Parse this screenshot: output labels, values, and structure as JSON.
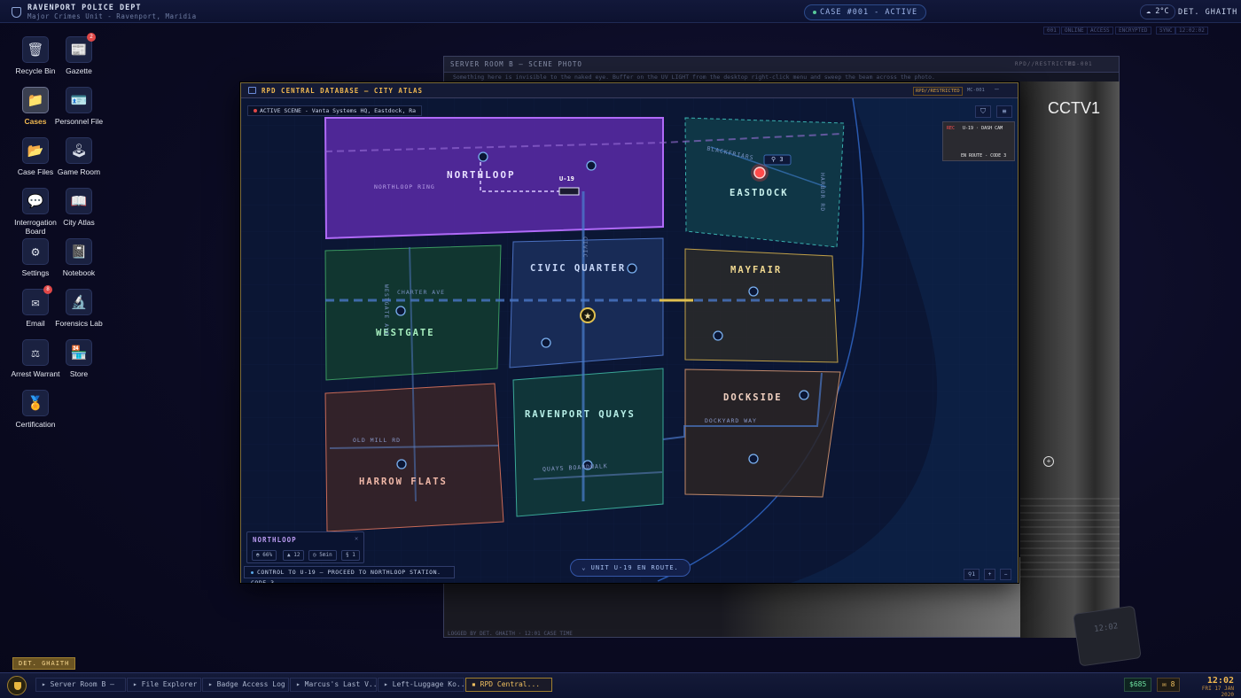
{
  "topbar": {
    "dept": "RAVENPORT POLICE DEPT",
    "unit": "Major Crimes Unit - Ravenport, Maridia",
    "case": "CASE #001 - ACTIVE",
    "weather": "2°C",
    "user": "DET. GHAITH",
    "status_chips": [
      "001",
      "ONLINE",
      "ACCESS",
      "ENCRYPTED",
      "SYNC",
      "12:02:02"
    ]
  },
  "desktop_icons": [
    {
      "label": "Recycle Bin",
      "icon": "trash-icon"
    },
    {
      "label": "Gazette",
      "icon": "newspaper-icon",
      "badge": "2"
    },
    {
      "label": "Cases",
      "icon": "folder-icon",
      "selected": true
    },
    {
      "label": "Personnel File",
      "icon": "id-card-icon"
    },
    {
      "label": "Case Files",
      "icon": "folder-icon"
    },
    {
      "label": "Game Room",
      "icon": "joystick-icon"
    },
    {
      "label": "Interrogation Board",
      "icon": "speech-bubble-icon"
    },
    {
      "label": "City Atlas",
      "icon": "map-book-icon"
    },
    {
      "label": "Settings",
      "icon": "gear-icon"
    },
    {
      "label": "Notebook",
      "icon": "notebook-icon"
    },
    {
      "label": "Email",
      "icon": "envelope-icon",
      "badge": "8"
    },
    {
      "label": "Forensics Lab",
      "icon": "microscope-icon"
    },
    {
      "label": "Arrest Warrant",
      "icon": "scales-icon"
    },
    {
      "label": "Store",
      "icon": "shop-icon"
    },
    {
      "label": "Certification",
      "icon": "medal-icon"
    }
  ],
  "server_window": {
    "title": "SERVER ROOM B — SCENE PHOTO",
    "restricted": "RPD//RESTRICTED",
    "code": "MC-001",
    "hint": "Something here is invisible to the naked eye. Buffer on the UV LIGHT from the desktop right-click menu and sweep the beam across the photo.",
    "cctv_label": "CCTV1",
    "timestamp": "12:02",
    "footer": "LOGGED BY DET. GHAITH · 12:01 CASE TIME"
  },
  "atlas_window": {
    "title": "RPD CENTRAL DATABASE — CITY ATLAS",
    "restricted": "RPD//RESTRICTED",
    "code": "MC-001",
    "active_scene": "ACTIVE SCENE - Vanta Systems HQ, Eastdock, Ra",
    "districts": [
      {
        "name": "NORTHLOOP",
        "color": "#8a50f0"
      },
      {
        "name": "EASTDOCK",
        "color": "#3aa8a0"
      },
      {
        "name": "CIVIC QUARTER",
        "color": "#4a70c0"
      },
      {
        "name": "MAYFAIR",
        "color": "#c0a048"
      },
      {
        "name": "WESTGATE",
        "color": "#3a9860"
      },
      {
        "name": "RAVENPORT QUAYS",
        "color": "#3aa898"
      },
      {
        "name": "DOCKSIDE",
        "color": "#c08868"
      },
      {
        "name": "HARROW FLATS",
        "color": "#c86a58"
      }
    ],
    "streets": [
      "NORTHLOOP RING",
      "CHARTER AVE",
      "WESTGATE AVE",
      "OLD MILL RD",
      "QUAYS BOARDWALK",
      "DOCKYARD WAY",
      "HARBOR RD",
      "BLACKFRIARS",
      "CIVIC"
    ],
    "unit_marker": "U-19",
    "blackfriars_count": "3",
    "inset": {
      "rec": "REC",
      "cam": "U-19 · DASH CAM",
      "status": "EN ROUTE - CODE 3"
    },
    "info_panel": {
      "name": "NORTHLOOP",
      "stats": [
        "66%",
        "12",
        "5min",
        "1"
      ]
    },
    "dispatch": "CONTROL TO U-19 — PROCEED TO NORTHLOOP STATION. CODE 3.",
    "unit_status": "UNIT U-19 EN ROUTE.",
    "controls": [
      "1",
      "+",
      "−"
    ]
  },
  "taskbar": {
    "user_chip": "DET. GHAITH",
    "items": [
      "Server Room B —",
      "File Explorer",
      "Badge Access Log",
      "Marcus's Last V...",
      "Left-Luggage Ko...",
      "RPD Central..."
    ],
    "money": "$685",
    "mail": "8",
    "time": "12:02",
    "date": "FRI 17 JAN 2020"
  }
}
